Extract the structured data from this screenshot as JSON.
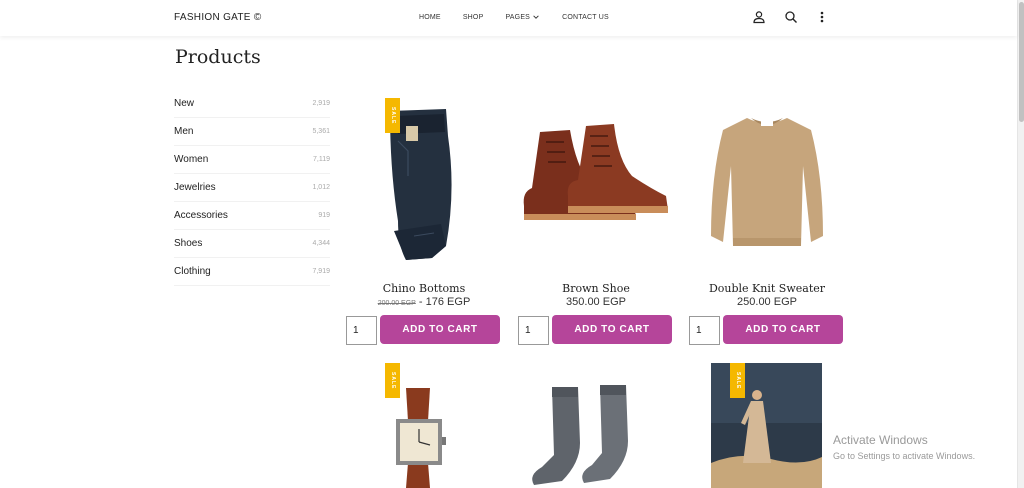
{
  "header": {
    "brand": "FASHION GATE ©",
    "nav": [
      "HOME",
      "SHOP",
      "PAGES",
      "CONTACT US"
    ]
  },
  "page": {
    "title": "Products"
  },
  "sidebar": {
    "categories": [
      {
        "name": "New",
        "count": "2,919"
      },
      {
        "name": "Men",
        "count": "5,361"
      },
      {
        "name": "Women",
        "count": "7,119"
      },
      {
        "name": "Jewelries",
        "count": "1,012"
      },
      {
        "name": "Accessories",
        "count": "919"
      },
      {
        "name": "Shoes",
        "count": "4,344"
      },
      {
        "name": "Clothing",
        "count": "7,919"
      }
    ]
  },
  "products": [
    {
      "name": "Chino Bottoms",
      "old_price": "200.00 EGP",
      "separator": "-",
      "price": "176 EGP",
      "qty": "1",
      "button": "ADD TO CART",
      "sale": "SALE"
    },
    {
      "name": "Brown Shoe",
      "price": "350.00 EGP",
      "qty": "1",
      "button": "ADD TO CART"
    },
    {
      "name": "Double Knit Sweater",
      "price": "250.00 EGP",
      "qty": "1",
      "button": "ADD TO CART"
    },
    {
      "sale": "SALE"
    },
    {},
    {
      "sale": "SALE"
    }
  ],
  "watermark": {
    "line1": "Activate Windows",
    "line2": "Go to Settings to activate Windows."
  },
  "colors": {
    "accent": "#b5459a",
    "sale_badge": "#f5b800"
  }
}
